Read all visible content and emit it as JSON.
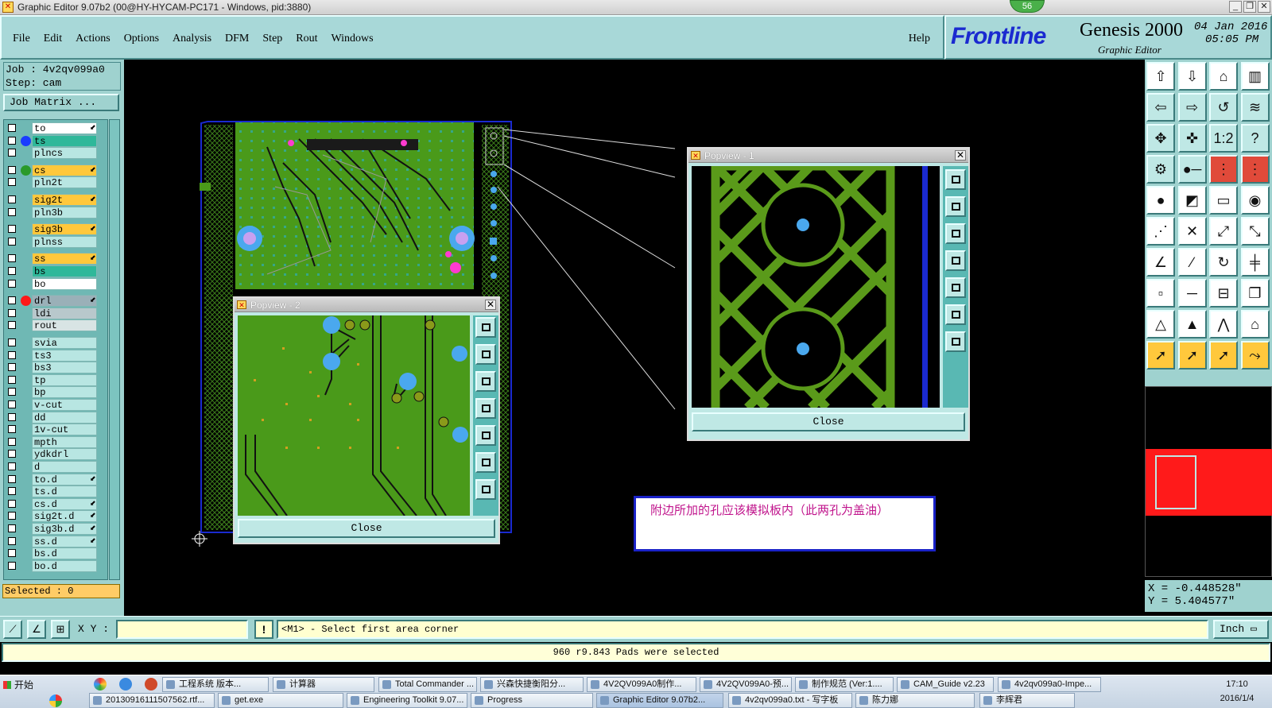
{
  "window": {
    "title": "Graphic Editor 9.07b2 (00@HY-HYCAM-PC171 - Windows, pid:3880)",
    "badge": "56"
  },
  "menu": {
    "items": [
      "File",
      "Edit",
      "Actions",
      "Options",
      "Analysis",
      "DFM",
      "Step",
      "Rout",
      "Windows"
    ],
    "help": "Help"
  },
  "brand": {
    "logo": "Frontline",
    "product": "Genesis 2000",
    "subtitle": "Graphic Editor",
    "date": "04 Jan 2016",
    "time": "05:05 PM"
  },
  "job": {
    "job_line": "Job : 4v2qv099a0",
    "step_line": "Step: cam",
    "matrix_button": "Job Matrix ..."
  },
  "layers": [
    {
      "name": "to",
      "dot": "",
      "bg": "#ffffff",
      "edit": true
    },
    {
      "name": "ts",
      "dot": "#1a3cff",
      "bg": "#2fb89a",
      "edit": false
    },
    {
      "name": "plncs",
      "dot": "",
      "bg": "#b8e6e2",
      "edit": false
    },
    {
      "name": "cs",
      "dot": "#2a9a2a",
      "bg": "#ffc83c",
      "edit": true
    },
    {
      "name": "pln2t",
      "dot": "",
      "bg": "#b8e6e2",
      "edit": false
    },
    {
      "name": "sig2t",
      "dot": "",
      "bg": "#ffc83c",
      "edit": true
    },
    {
      "name": "pln3b",
      "dot": "",
      "bg": "#b8e6e2",
      "edit": false
    },
    {
      "name": "sig3b",
      "dot": "",
      "bg": "#ffc83c",
      "edit": true
    },
    {
      "name": "plnss",
      "dot": "",
      "bg": "#b8e6e2",
      "edit": false
    },
    {
      "name": "ss",
      "dot": "",
      "bg": "#ffc83c",
      "edit": true
    },
    {
      "name": "bs",
      "dot": "",
      "bg": "#2fb89a",
      "edit": false
    },
    {
      "name": "bo",
      "dot": "",
      "bg": "#ffffff",
      "edit": false
    },
    {
      "name": "drl",
      "dot": "#ff1a1a",
      "bg": "#9ab0b8",
      "edit": true
    },
    {
      "name": "ldi",
      "dot": "",
      "bg": "#b8c8cc",
      "edit": false
    },
    {
      "name": "rout",
      "dot": "",
      "bg": "#d8e4e4",
      "edit": false
    },
    {
      "name": "svia",
      "dot": "",
      "bg": "#b8e6e2",
      "edit": false
    },
    {
      "name": "ts3",
      "dot": "",
      "bg": "#b8e6e2",
      "edit": false
    },
    {
      "name": "bs3",
      "dot": "",
      "bg": "#b8e6e2",
      "edit": false
    },
    {
      "name": "tp",
      "dot": "",
      "bg": "#b8e6e2",
      "edit": false
    },
    {
      "name": "bp",
      "dot": "",
      "bg": "#b8e6e2",
      "edit": false
    },
    {
      "name": "v-cut",
      "dot": "",
      "bg": "#b8e6e2",
      "edit": false
    },
    {
      "name": "dd",
      "dot": "",
      "bg": "#b8e6e2",
      "edit": false
    },
    {
      "name": "1v-cut",
      "dot": "",
      "bg": "#b8e6e2",
      "edit": false
    },
    {
      "name": "mpth",
      "dot": "",
      "bg": "#b8e6e2",
      "edit": false
    },
    {
      "name": "ydkdrl",
      "dot": "",
      "bg": "#b8e6e2",
      "edit": false
    },
    {
      "name": "d",
      "dot": "",
      "bg": "#b8e6e2",
      "edit": false
    },
    {
      "name": "to.d",
      "dot": "",
      "bg": "#b8e6e2",
      "edit": true
    },
    {
      "name": "ts.d",
      "dot": "",
      "bg": "#b8e6e2",
      "edit": false
    },
    {
      "name": "cs.d",
      "dot": "",
      "bg": "#b8e6e2",
      "edit": true
    },
    {
      "name": "sig2t.d",
      "dot": "",
      "bg": "#b8e6e2",
      "edit": true
    },
    {
      "name": "sig3b.d",
      "dot": "",
      "bg": "#b8e6e2",
      "edit": true
    },
    {
      "name": "ss.d",
      "dot": "",
      "bg": "#b8e6e2",
      "edit": true
    },
    {
      "name": "bs.d",
      "dot": "",
      "bg": "#b8e6e2",
      "edit": false
    },
    {
      "name": "bo.d",
      "dot": "",
      "bg": "#b8e6e2",
      "edit": false
    }
  ],
  "selected": "Selected : 0",
  "popview1": {
    "title": "Popview - 1",
    "close": "Close"
  },
  "popview2": {
    "title": "Popview - 2",
    "close": "Close"
  },
  "note": "附边所加的孔应该模拟板内（此两孔为盖油）",
  "coords": {
    "x": "X = -0.448528\"",
    "y": "Y =  5.404577\""
  },
  "cmd": {
    "xy_label": "X Y :",
    "xy_value": "",
    "bang": "!",
    "prompt": "<M1> - Select first area corner",
    "units": "Inch"
  },
  "status": "960 r9.843 Pads were selected",
  "taskbar": {
    "start": "开始",
    "row1": [
      "工程系统  版本...",
      "计算器",
      "Total Commander ...",
      "兴森快捷衡阳分...",
      "4V2QV099A0制作...",
      "4V2QV099A0-预...",
      "制作规范 (Ver:1....",
      "CAM_Guide v2.23",
      "4v2qv099a0-Impe..."
    ],
    "row2": [
      "20130916111507562.rtf...",
      "get.exe",
      "Engineering Toolkit 9.07...",
      "Progress",
      "Graphic Editor 9.07b2...",
      "4v2qv099a0.txt - 写字板",
      "陈力娜",
      "李辉君"
    ],
    "clock_time": "17:10",
    "clock_date": "2016/1/4"
  },
  "colors": {
    "panel": "#9fd2cf",
    "board_green": "#4a9a1a",
    "copper_green": "#5a9a1a",
    "pad_blue": "#4aa8ee",
    "annotation_pink": "#c0148c",
    "annotation_border": "#1a22c8"
  }
}
